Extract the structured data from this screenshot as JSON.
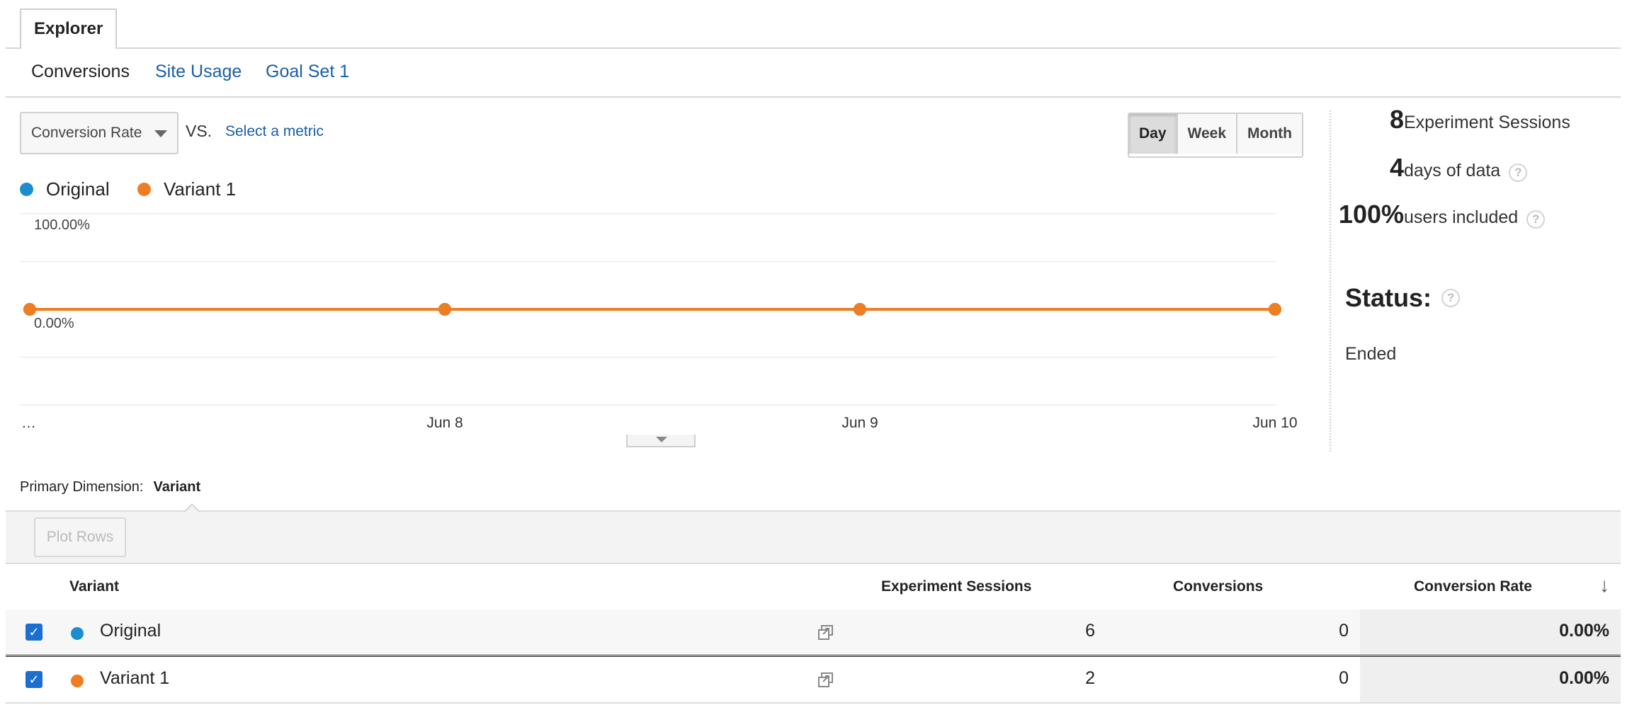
{
  "tabs": {
    "explorer": "Explorer"
  },
  "subtabs": {
    "conversions": "Conversions",
    "site_usage": "Site Usage",
    "goal_set": "Goal Set 1"
  },
  "metric": {
    "selected": "Conversion Rate",
    "vs": "VS.",
    "select_metric": "Select a metric"
  },
  "period": {
    "day": "Day",
    "week": "Week",
    "month": "Month",
    "active": "Day"
  },
  "legend": {
    "original": "Original",
    "variant": "Variant 1"
  },
  "colors": {
    "original": "#1a8ecf",
    "variant": "#ef7d22",
    "link": "#1a5fa6"
  },
  "chart_data": {
    "type": "line",
    "x": [
      "…",
      "Jun 8",
      "Jun 9",
      "Jun 10"
    ],
    "ytick_labels": [
      "100.00%",
      "0.00%"
    ],
    "ylim": [
      -1,
      1
    ],
    "series": [
      {
        "name": "Original",
        "values": [
          0,
          0,
          0,
          0
        ]
      },
      {
        "name": "Variant 1",
        "values": [
          0,
          0,
          0,
          0
        ]
      }
    ],
    "grid": true
  },
  "stats": {
    "sessions_num": "8",
    "sessions_label": "Experiment Sessions",
    "days_num": "4",
    "days_label": "days of data",
    "users_num": "100%",
    "users_label": "users included"
  },
  "status": {
    "title": "Status:",
    "value": "Ended"
  },
  "help_glyph": "?",
  "dimension": {
    "label": "Primary Dimension:",
    "value": "Variant"
  },
  "plot_rows": "Plot Rows",
  "table": {
    "headers": {
      "variant": "Variant",
      "sessions": "Experiment Sessions",
      "conversions": "Conversions",
      "rate": "Conversion Rate",
      "sort_icon": "↓"
    },
    "rows": [
      {
        "name": "Original",
        "sessions": "6",
        "conversions": "0",
        "rate": "0.00%"
      },
      {
        "name": "Variant 1",
        "sessions": "2",
        "conversions": "0",
        "rate": "0.00%"
      }
    ]
  }
}
